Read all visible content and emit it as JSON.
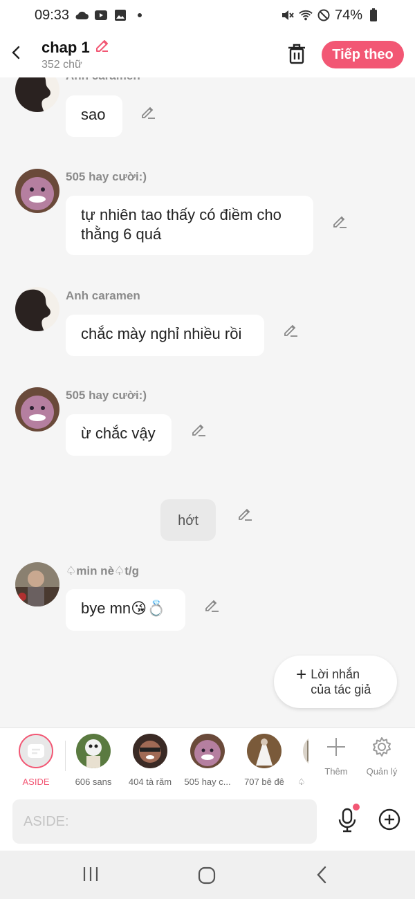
{
  "status": {
    "time": "09:33",
    "battery": "74%"
  },
  "header": {
    "title": "chap 1",
    "subtitle": "352 chữ",
    "next_label": "Tiếp theo"
  },
  "messages": [
    {
      "author": "Anh caramen",
      "text": "sao"
    },
    {
      "author": "505 hay cười:)",
      "text": "tự nhiên tao thấy có điềm cho thằng 6 quá"
    },
    {
      "author": "Anh caramen",
      "text": "chắc mày nghỉ nhiều rồi"
    },
    {
      "author": "505 hay cười:)",
      "text": "ừ chắc vậy"
    },
    {
      "aside": "hớt"
    },
    {
      "author": "♤min nè♤t/g",
      "text": "bye mn😘💍"
    }
  ],
  "author_note": {
    "plus": "+",
    "label": "Lời nhắn của tác giả"
  },
  "characters": {
    "aside_label": "ASIDE",
    "items": [
      {
        "name": "606 sans"
      },
      {
        "name": "404 tà răm"
      },
      {
        "name": "505 hay c..."
      },
      {
        "name": "707 bê đê"
      },
      {
        "name": "♤"
      }
    ],
    "add_label": "Thêm",
    "manage_label": "Quản lý"
  },
  "composer": {
    "placeholder": "ASIDE:"
  },
  "colors": {
    "accent": "#f25774",
    "background": "#f5f5f5",
    "bubble": "#ffffff",
    "aside_bubble": "#e9e9e9"
  }
}
